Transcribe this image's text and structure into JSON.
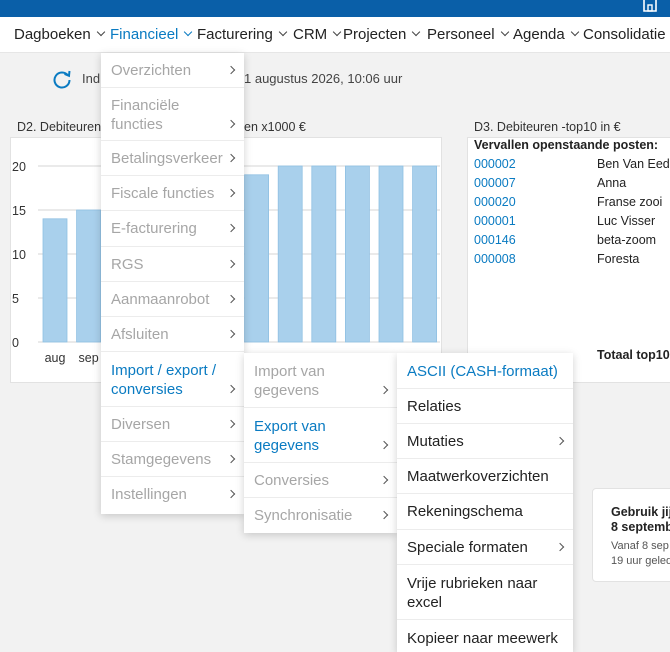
{
  "nav": {
    "items": [
      {
        "label": "Dagboeken"
      },
      {
        "label": "Financieel"
      },
      {
        "label": "Facturering"
      },
      {
        "label": "CRM"
      },
      {
        "label": "Projecten"
      },
      {
        "label": "Personeel"
      },
      {
        "label": "Agenda"
      },
      {
        "label": "Consolidatie"
      }
    ]
  },
  "status": {
    "prefix": "Ind",
    "datetime": "1 augustus 2026, 10:06 uur"
  },
  "chart_widget": {
    "title_left": "D2. Debiteuren",
    "title_right": "en x1000 €"
  },
  "chart_data": {
    "type": "bar",
    "categories": [
      "aug",
      "sep",
      "",
      "",
      "",
      "",
      "",
      "",
      "",
      "",
      "",
      ""
    ],
    "values": [
      14,
      15,
      15,
      15,
      17,
      18,
      19,
      20,
      20,
      20,
      20,
      20
    ],
    "ylim": [
      0,
      20
    ],
    "yticks": [
      0,
      5,
      10,
      15,
      20
    ],
    "grid": true,
    "color": "#a9d0ec"
  },
  "debtors": {
    "title": "D3. Debiteuren -top10 in €",
    "subtitle": "Vervallen openstaande posten:",
    "rows": [
      {
        "code": "000002",
        "name": "Ben Van Eed"
      },
      {
        "code": "000007",
        "name": "Anna"
      },
      {
        "code": "000020",
        "name": "Franse zooi"
      },
      {
        "code": "000001",
        "name": "Luc Visser"
      },
      {
        "code": "000146",
        "name": "beta-zoom"
      },
      {
        "code": "000008",
        "name": "Foresta"
      }
    ],
    "total_label": "Totaal top10"
  },
  "notice": {
    "title_line1": "Gebruik jij",
    "title_line2": "8 septemb",
    "body_line1": "Vanaf 8 sep",
    "body_line2": "19 uur geled"
  },
  "menu1": {
    "items": [
      {
        "line1": "Overzichten",
        "line2": ""
      },
      {
        "line1": "Financiële",
        "line2": "functies"
      },
      {
        "line1": "Betalingsverkeer",
        "line2": ""
      },
      {
        "line1": "Fiscale functies",
        "line2": ""
      },
      {
        "line1": "E-facturering",
        "line2": ""
      },
      {
        "line1": "RGS",
        "line2": ""
      },
      {
        "line1": "Aanmaanrobot",
        "line2": ""
      },
      {
        "line1": "Afsluiten",
        "line2": ""
      },
      {
        "line1": "Import / export /",
        "line2": "conversies"
      },
      {
        "line1": "Diversen",
        "line2": ""
      },
      {
        "line1": "Stamgegevens",
        "line2": ""
      },
      {
        "line1": "Instellingen",
        "line2": ""
      }
    ]
  },
  "menu2": {
    "items": [
      {
        "line1": "Import van",
        "line2": "gegevens"
      },
      {
        "line1": "Export van",
        "line2": "gegevens"
      },
      {
        "line1": "Conversies",
        "line2": ""
      },
      {
        "line1": "Synchronisatie",
        "line2": ""
      }
    ]
  },
  "menu3": {
    "items": [
      {
        "line1": "ASCII (CASH-formaat)",
        "line2": ""
      },
      {
        "line1": "Relaties",
        "line2": ""
      },
      {
        "line1": "Mutaties",
        "line2": ""
      },
      {
        "line1": "Maatwerkoverzichten",
        "line2": ""
      },
      {
        "line1": "Rekeningschema",
        "line2": ""
      },
      {
        "line1": "Speciale formaten",
        "line2": ""
      },
      {
        "line1": "Vrije rubrieken naar",
        "line2": "excel"
      },
      {
        "line1": "Kopieer naar meewerk",
        "line2": ""
      }
    ]
  }
}
